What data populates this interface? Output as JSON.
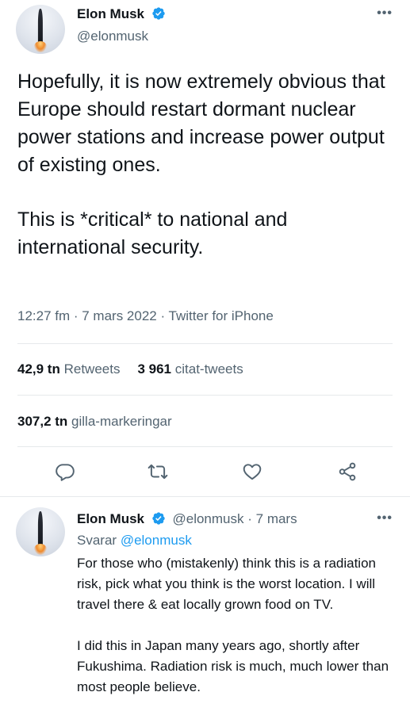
{
  "tweet": {
    "author_name": "Elon Musk",
    "author_handle": "@elonmusk",
    "more_label": "•••",
    "paragraphs": [
      "Hopefully, it is now extremely obvious that Europe should restart dormant nuclear power stations and increase power output of existing ones.",
      "This is *critical* to national and international security."
    ],
    "timestamp": "12:27 fm · 7 mars 2022 · Twitter for iPhone",
    "retweets_count": "42,9 tn",
    "retweets_label": "Retweets",
    "quotes_count": "3 961",
    "quotes_label": "citat-tweets",
    "likes_count": "307,2 tn",
    "likes_label": "gilla-markeringar",
    "actions": [
      "reply-icon",
      "retweet-icon",
      "like-icon",
      "share-icon"
    ]
  },
  "reply": {
    "author_name": "Elon Musk",
    "author_handle": "@elonmusk",
    "dot": "·",
    "date": "7 mars",
    "more_label": "•••",
    "replying_prefix": "Svarar",
    "replying_to": "@elonmusk",
    "paragraphs": [
      "For those who (mistakenly) think this is a radiation risk, pick what you think is the worst location. I will travel there & eat locally grown food on TV.",
      "I did this in Japan many years ago, shortly after Fukushima. Radiation risk is much, much lower than most people believe."
    ]
  },
  "colors": {
    "text": "#0f1419",
    "secondary": "#536471",
    "accent": "#1d9bf0",
    "divider": "#e6e9eb"
  }
}
